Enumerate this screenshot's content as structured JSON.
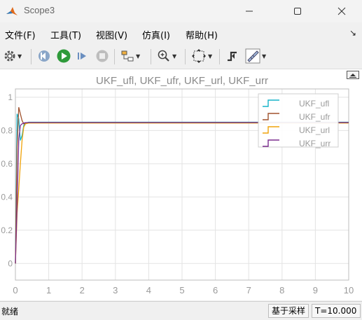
{
  "window": {
    "title": "Scope3"
  },
  "menu": [
    "文件(F)",
    "工具(T)",
    "视图(V)",
    "仿真(I)",
    "帮助(H)"
  ],
  "plot": {
    "title": "UKF_ufl, UKF_ufr, UKF_url, UKF_urr"
  },
  "colors": {
    "ufl": "#16b3c9",
    "ufr": "#a0522d",
    "url": "#f0a30a",
    "urr": "#7b2d8e"
  },
  "chart_data": {
    "type": "line",
    "title": "UKF_ufl, UKF_ufr, UKF_url, UKF_urr",
    "xlabel": "",
    "ylabel": "",
    "xlim": [
      0,
      10
    ],
    "ylim": [
      -0.1,
      1.05
    ],
    "x_ticks": [
      "0",
      "1",
      "2",
      "3",
      "4",
      "5",
      "6",
      "7",
      "8",
      "9",
      "10"
    ],
    "y_ticks": [
      "0",
      "0.2",
      "0.4",
      "0.6",
      "0.8",
      "1"
    ],
    "grid": true,
    "legend_position": "top-right",
    "series": [
      {
        "name": "UKF_ufl",
        "x": [
          0,
          0.05,
          0.1,
          0.15,
          0.2,
          0.25,
          0.3,
          0.4,
          10
        ],
        "y": [
          0,
          0.9,
          0.87,
          0.74,
          0.77,
          0.83,
          0.845,
          0.85,
          0.85
        ]
      },
      {
        "name": "UKF_ufr",
        "x": [
          0,
          0.05,
          0.1,
          0.15,
          0.2,
          0.25,
          0.3,
          0.4,
          10
        ],
        "y": [
          0,
          0.7,
          0.94,
          0.9,
          0.86,
          0.84,
          0.845,
          0.848,
          0.848
        ]
      },
      {
        "name": "UKF_url",
        "x": [
          0,
          0.05,
          0.1,
          0.15,
          0.2,
          0.25,
          0.3,
          0.4,
          10
        ],
        "y": [
          0,
          0.3,
          0.45,
          0.6,
          0.74,
          0.82,
          0.84,
          0.845,
          0.845
        ]
      },
      {
        "name": "UKF_urr",
        "x": [
          0,
          0.05,
          0.1,
          0.15,
          0.2,
          0.25,
          0.3,
          0.4,
          10
        ],
        "y": [
          0,
          0.35,
          0.75,
          0.83,
          0.84,
          0.845,
          0.847,
          0.848,
          0.848
        ]
      }
    ]
  },
  "status": {
    "left": "就绪",
    "mode": "基于采样",
    "time": "T=10.000"
  }
}
